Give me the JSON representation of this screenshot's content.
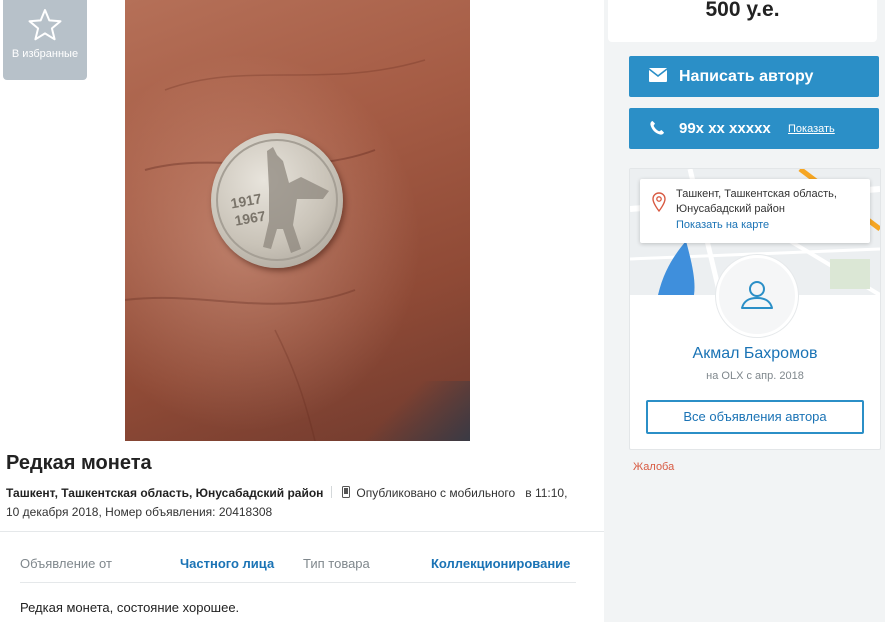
{
  "favorite": {
    "label": "В избранные",
    "icon": "star-icon"
  },
  "ad": {
    "title": "Редкая монета",
    "location": "Ташкент, Ташкентская область, Юнусабадский район",
    "published_prefix": "Опубликовано с мобильного",
    "published_time": "в 11:10,",
    "published_date_and_id": "10 декабря 2018, Номер объявления: 20418308",
    "details": [
      {
        "key": "Объявление от",
        "value": "Частного лица"
      },
      {
        "key": "Тип товара",
        "value": "Коллекционирование"
      }
    ],
    "description": "Редкая монета, состояние хорошее.",
    "coin_text": {
      "year1": "1917",
      "year2": "1967"
    }
  },
  "sidebar": {
    "price": "500 у.е.",
    "write_button": {
      "label": "Написать автору",
      "icon": "envelope-icon"
    },
    "phone_button": {
      "number": "99x xx xxxxx",
      "show_label": "Показать",
      "icon": "phone-icon"
    },
    "location_popup": {
      "address": "Ташкент, Ташкентская область, Юнусабадский район",
      "map_link": "Показать на карте"
    },
    "seller": {
      "name": "Акмал Бахромов",
      "since": "на OLX с апр. 2018",
      "all_ads_button": "Все объявления автора"
    },
    "complaint_link": "Жалоба"
  },
  "colors": {
    "accent": "#2b8fc7",
    "link": "#1a73b5",
    "complaint": "#d85a42",
    "fav_bg": "#b7c1c9"
  }
}
